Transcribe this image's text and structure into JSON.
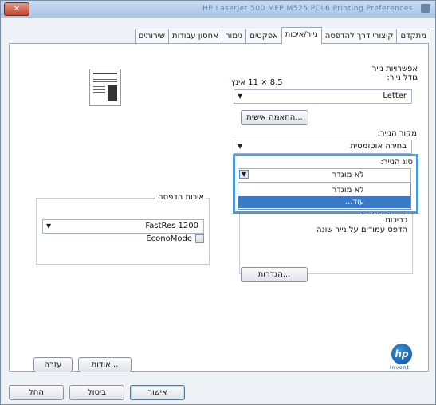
{
  "window": {
    "title": "HP LaserJet 500 MFP M525 PCL6 Printing Preferences",
    "close_label": "✕"
  },
  "tabs": [
    {
      "label": "מתקדם"
    },
    {
      "label": "קיצורי דרך להדפסה"
    },
    {
      "label": "נייר/איכות",
      "active": true
    },
    {
      "label": "אפקטים"
    },
    {
      "label": "גימור"
    },
    {
      "label": "אחסון עבודות"
    },
    {
      "label": "שירותים"
    }
  ],
  "paper_options": {
    "section_label": "אפשרויות נייר",
    "size_label": "גודל נייר:",
    "size_hint": "8.5 × 11 אינץ'",
    "size_value": "Letter",
    "custom_button": "התאמה אישית...",
    "source_label": "מקור הנייר:",
    "source_value": "בחירה אוטומטית",
    "type_label": "סוג הנייר:",
    "type_value": "לא מוגדר",
    "type_options": [
      {
        "label": "לא מוגדר",
        "selected": false
      },
      {
        "label": "עוד...",
        "selected": true
      }
    ]
  },
  "special_pages": {
    "partial_label": "דפים מיוחדים:",
    "covers_label": "כריכות",
    "print_pages_label": "הדפס עמודים על נייר שונה",
    "settings_button": "הגדרות..."
  },
  "print_quality": {
    "group_label": "איכות הדפסה",
    "resolution_value": "FastRes 1200",
    "econo_label": "EconoMode"
  },
  "buttons": {
    "about": "אודות...",
    "help": "עזרה",
    "ok": "אישור",
    "cancel": "ביטול",
    "apply": "החל"
  },
  "logo": {
    "text": "hp",
    "tagline": "invent"
  }
}
